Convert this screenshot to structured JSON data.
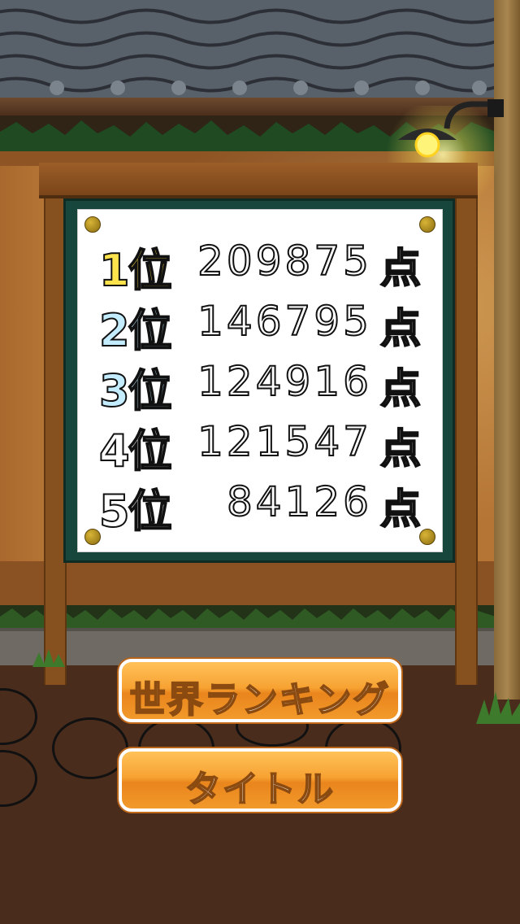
{
  "rankings": [
    {
      "rank_label": "1位",
      "score": "209875",
      "unit": "点"
    },
    {
      "rank_label": "2位",
      "score": "146795",
      "unit": "点"
    },
    {
      "rank_label": "3位",
      "score": "124916",
      "unit": "点"
    },
    {
      "rank_label": "4位",
      "score": "121547",
      "unit": "点"
    },
    {
      "rank_label": "5位",
      "score": "84126",
      "unit": "点"
    }
  ],
  "buttons": {
    "world_ranking": "世界ランキング",
    "title": "タイトル"
  },
  "colors": {
    "first_place": "#ffe34d",
    "second_third_place": "#c4ecff",
    "button_orange": "#f7a233",
    "board_green": "#17463c"
  }
}
